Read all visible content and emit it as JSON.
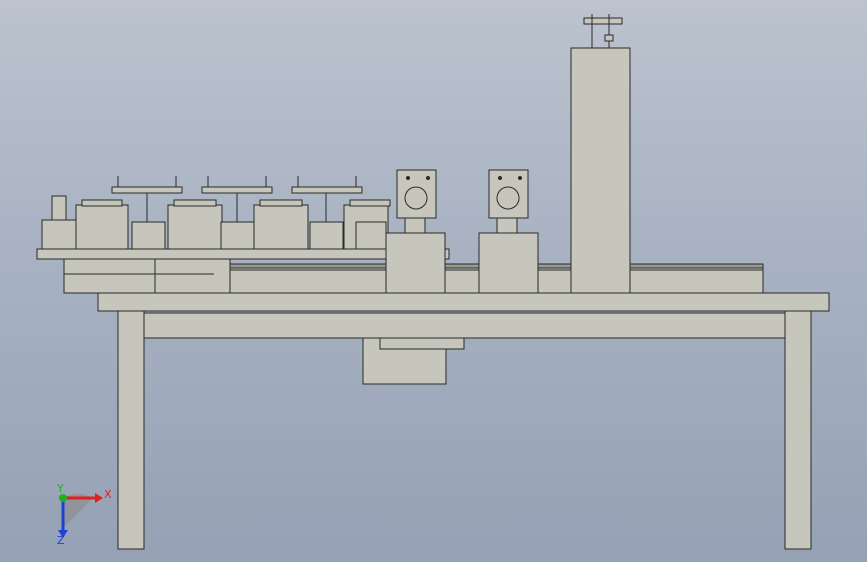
{
  "view": {
    "background_colors": [
      "#bcc3cf",
      "#95a1b4"
    ],
    "part_color": "#c6c6bc",
    "edge_color": "#2a2a2a"
  },
  "triad": {
    "x_label": "X",
    "y_label": "Y",
    "z_label": "Z",
    "x_color": "#e02020",
    "y_color": "#20b020",
    "z_color": "#2040d0"
  }
}
